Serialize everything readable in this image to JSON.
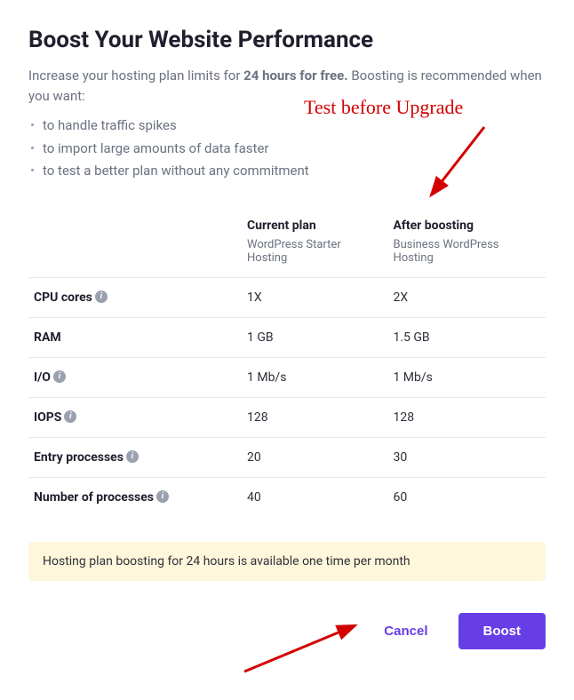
{
  "title": "Boost Your Website Performance",
  "intro": {
    "pre": "Increase your hosting plan limits for ",
    "bold": "24 hours for free.",
    "post": " Boosting is recommended when you want:"
  },
  "bullets": [
    "to handle traffic spikes",
    "to import large amounts of data faster",
    "to test a better plan without any commitment"
  ],
  "columns": {
    "current": {
      "label": "Current plan",
      "plan": "WordPress Starter Hosting"
    },
    "boosted": {
      "label": "After boosting",
      "plan": "Business WordPress Hosting"
    }
  },
  "rows": [
    {
      "label": "CPU cores",
      "info": true,
      "current": "1X",
      "boosted": "2X"
    },
    {
      "label": "RAM",
      "info": false,
      "current": "1 GB",
      "boosted": "1.5 GB"
    },
    {
      "label": "I/O",
      "info": true,
      "current": "1 Mb/s",
      "boosted": "1 Mb/s"
    },
    {
      "label": "IOPS",
      "info": true,
      "current": "128",
      "boosted": "128"
    },
    {
      "label": "Entry processes",
      "info": true,
      "current": "20",
      "boosted": "30"
    },
    {
      "label": "Number of processes",
      "info": true,
      "current": "40",
      "boosted": "60"
    }
  ],
  "notice": "Hosting plan boosting for 24 hours is available one time per month",
  "actions": {
    "cancel": "Cancel",
    "boost": "Boost"
  },
  "annotation": {
    "text": "Test before Upgrade"
  }
}
